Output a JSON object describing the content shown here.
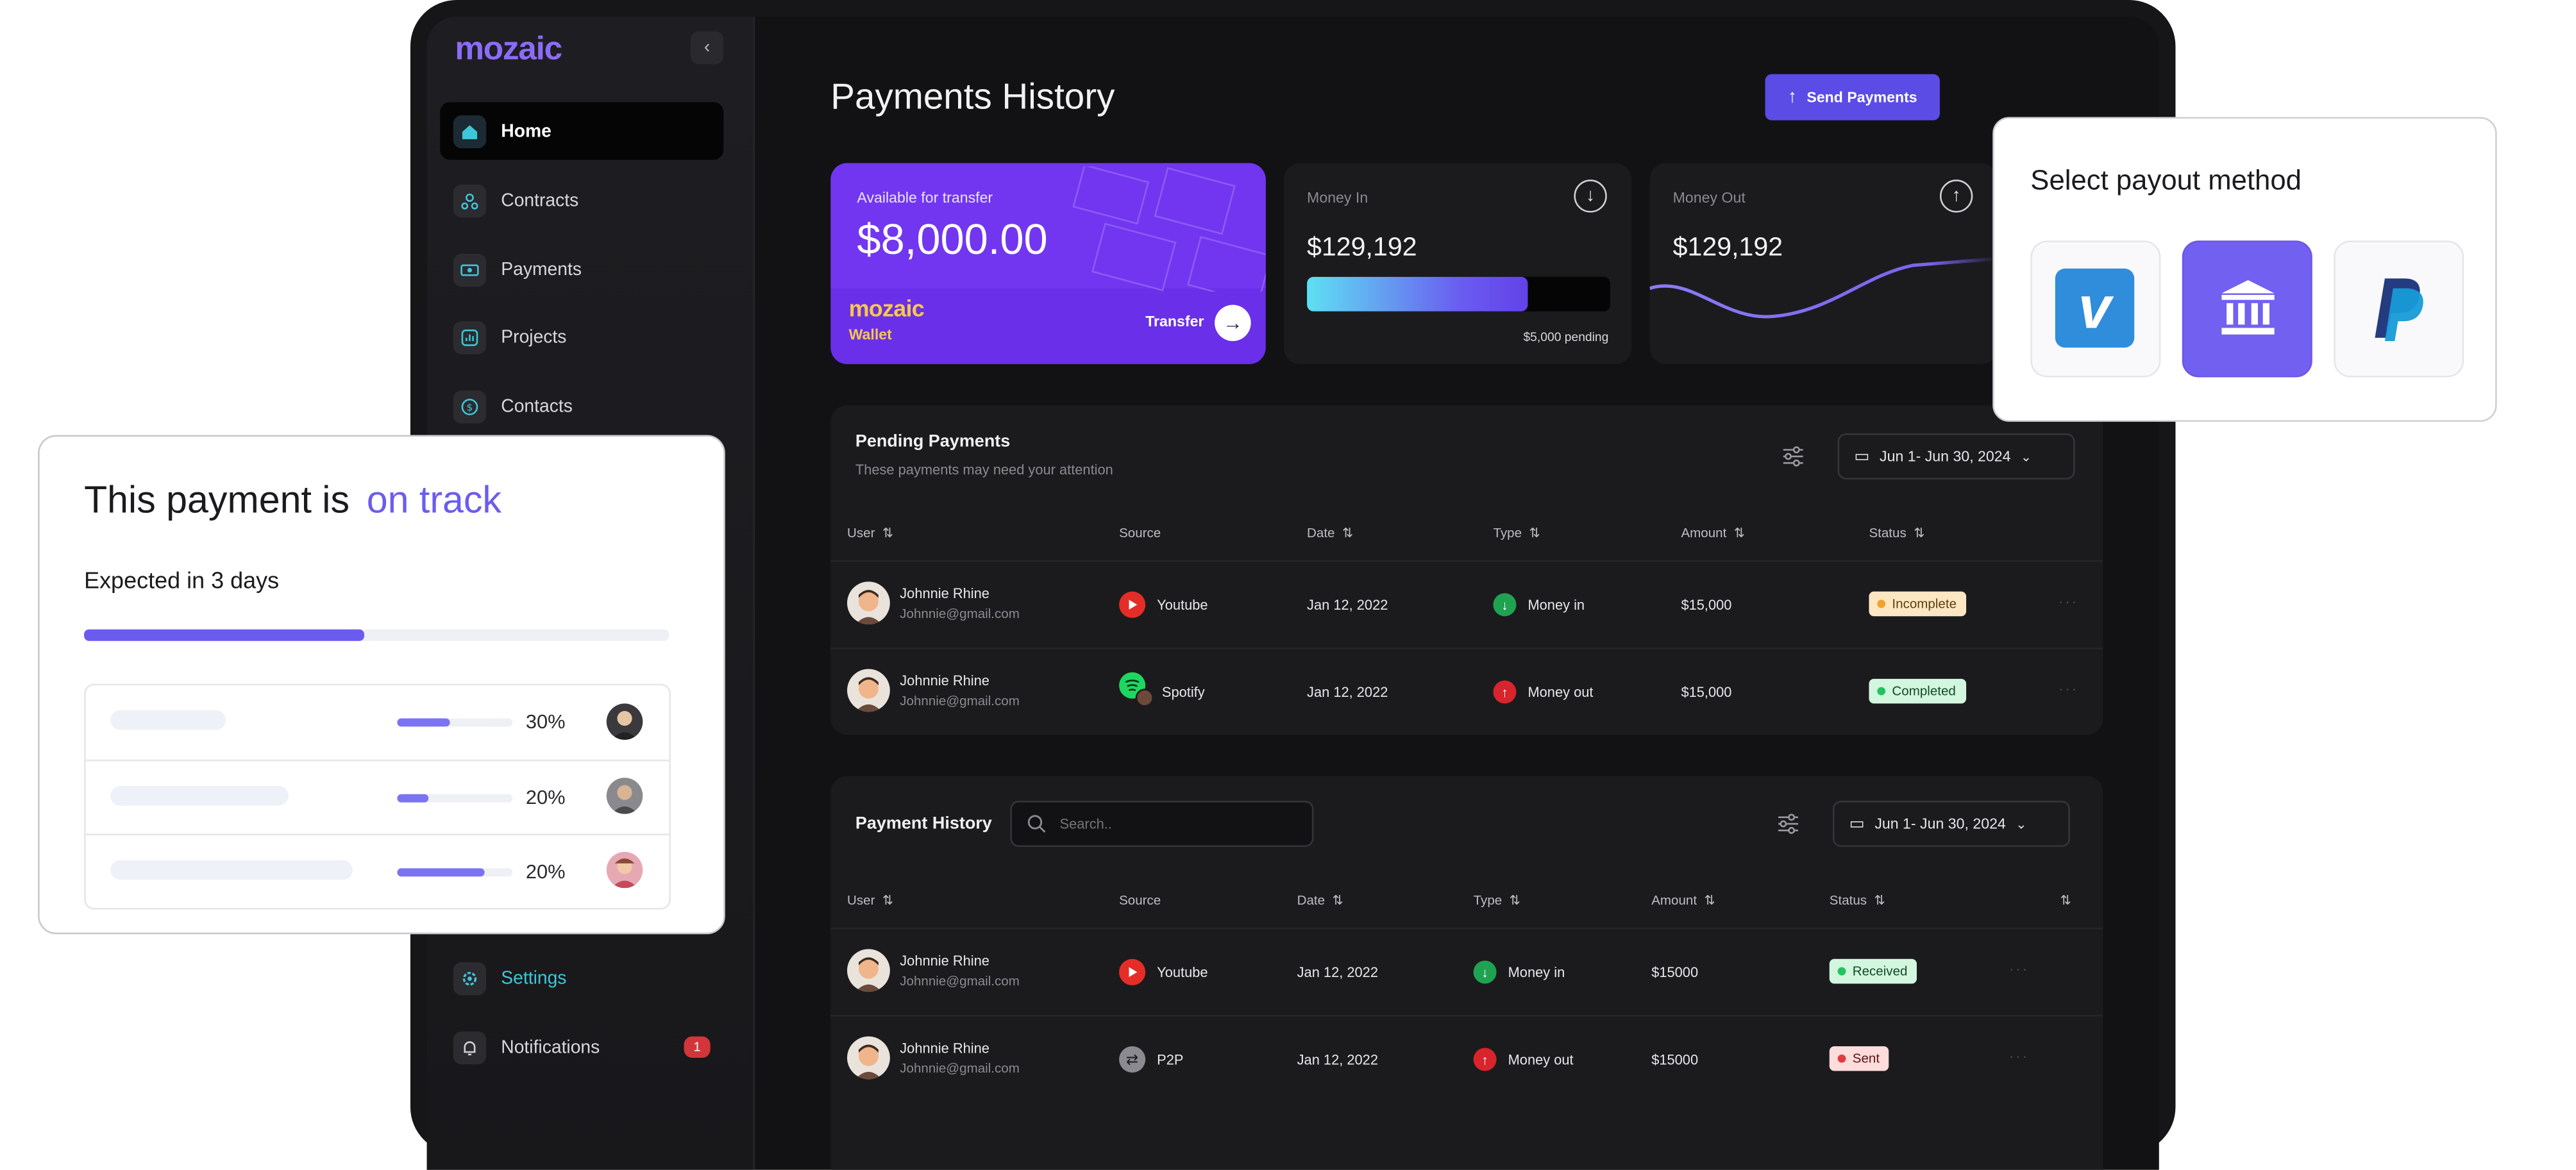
{
  "app": {
    "logo": "mozaic"
  },
  "sidebar": {
    "items": [
      {
        "label": "Home",
        "icon": "home-icon",
        "active": true
      },
      {
        "label": "Contracts",
        "icon": "contracts-icon"
      },
      {
        "label": "Payments",
        "icon": "payments-icon"
      },
      {
        "label": "Projects",
        "icon": "projects-icon"
      },
      {
        "label": "Contacts",
        "icon": "contacts-icon"
      }
    ],
    "settings": "Settings",
    "notifications": "Notifications",
    "notifications_count": "1"
  },
  "page": {
    "title": "Payments History",
    "send_button": "Send Payments"
  },
  "wallet": {
    "label": "Available for transfer",
    "amount": "$8,000.00",
    "brand": "mozaic",
    "brand_sub": "Wallet",
    "transfer": "Transfer"
  },
  "money_in": {
    "label": "Money In",
    "amount": "$129,192",
    "pending": "$5,000 pending",
    "progress": 0.73
  },
  "money_out": {
    "label": "Money Out",
    "amount": "$129,192"
  },
  "pending": {
    "title": "Pending Payments",
    "subtitle": "These payments may need your attention",
    "date_range": "Jun 1- Jun 30, 2024",
    "columns": [
      "User",
      "Source",
      "Date",
      "Type",
      "Amount",
      "Status"
    ],
    "rows": [
      {
        "name": "Johnnie Rhine",
        "email": "Johnnie@gmail.com",
        "source": "Youtube",
        "date": "Jan 12, 2022",
        "type": "Money in",
        "amount": "$15,000",
        "status": "Incomplete"
      },
      {
        "name": "Johnnie Rhine",
        "email": "Johnnie@gmail.com",
        "source": "Spotify",
        "date": "Jan 12, 2022",
        "type": "Money out",
        "amount": "$15,000",
        "status": "Completed"
      }
    ]
  },
  "history": {
    "title": "Payment History",
    "search_placeholder": "Search..",
    "date_range": "Jun 1- Jun 30, 2024",
    "columns": [
      "User",
      "Source",
      "Date",
      "Type",
      "Amount",
      "Status"
    ],
    "rows": [
      {
        "name": "Johnnie Rhine",
        "email": "Johnnie@gmail.com",
        "source": "Youtube",
        "date": "Jan 12, 2022",
        "type": "Money in",
        "amount": "$15000",
        "status": "Received"
      },
      {
        "name": "Johnnie Rhine",
        "email": "Johnnie@gmail.com",
        "source": "P2P",
        "date": "Jan 12, 2022",
        "type": "Money out",
        "amount": "$15000",
        "status": "Sent"
      }
    ]
  },
  "payout": {
    "title": "Select payout method",
    "methods": [
      "venmo",
      "bank",
      "paypal"
    ],
    "selected": "bank"
  },
  "track": {
    "title": "This payment is",
    "title_accent": "on track",
    "expected": "Expected in 3 days",
    "progress": 0.48,
    "rows": [
      {
        "pct": "30%",
        "fill": 0.45
      },
      {
        "pct": "20%",
        "fill": 0.27
      },
      {
        "pct": "20%",
        "fill": 0.75
      }
    ]
  },
  "colors": {
    "accent": "#5b4ce6",
    "wallet": "#6a2fe8",
    "settings_accent": "#3ec7d8",
    "mozaic_yellow": "#f7c84a"
  }
}
